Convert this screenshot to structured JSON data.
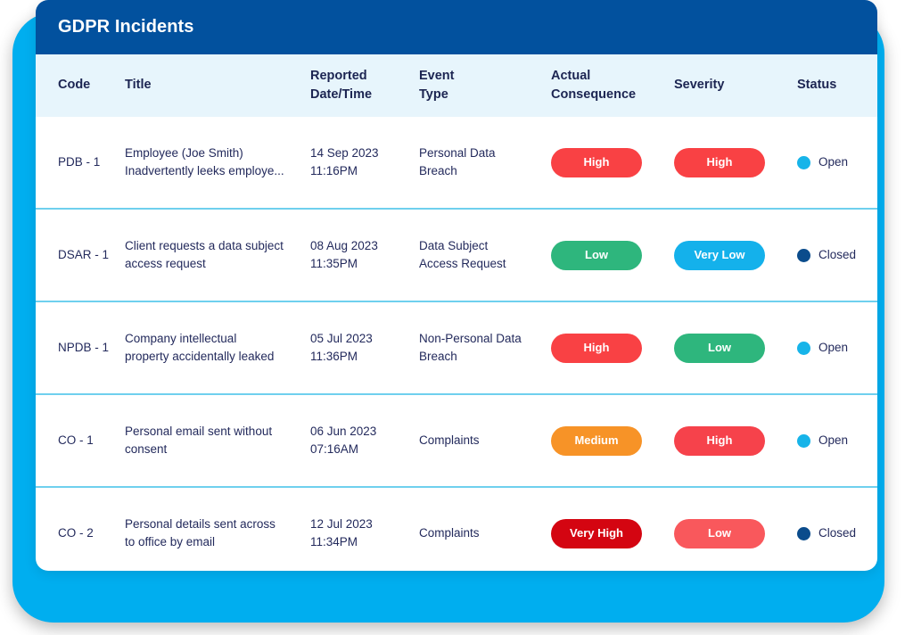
{
  "header": {
    "title": "GDPR Incidents",
    "bar_color": "#02519E",
    "text_color": "#FFFFFF"
  },
  "theme": {
    "backdrop_color": "#00AEEF",
    "card_color": "#FFFFFF",
    "table_header_bg": "#E7F5FC",
    "row_divider": "#6FD0EE",
    "text_color": "#232A5C"
  },
  "table": {
    "columns": [
      {
        "key": "code",
        "label": "Code"
      },
      {
        "key": "title",
        "label": "Title"
      },
      {
        "key": "reported",
        "label": "Reported\nDate/Time"
      },
      {
        "key": "event",
        "label": "Event\nType"
      },
      {
        "key": "cons",
        "label": "Actual\nConsequence"
      },
      {
        "key": "severity",
        "label": "Severity"
      },
      {
        "key": "status",
        "label": "Status"
      }
    ],
    "rows": [
      {
        "code": "PDB - 1",
        "title": "Employee (Joe Smith)\nInadvertently leeks employe...",
        "reported": "14 Sep 2023\n11:16PM",
        "event": "Personal Data\nBreach",
        "consequence": {
          "label": "High",
          "color": "#F94144"
        },
        "severity": {
          "label": "High",
          "color": "#F94144"
        },
        "status": {
          "label": "Open",
          "color": "#17B4E9"
        }
      },
      {
        "code": "DSAR - 1",
        "title": "Client requests a data subject\naccess request",
        "reported": "08 Aug 2023\n11:35PM",
        "event": "Data Subject\nAccess Request",
        "consequence": {
          "label": "Low",
          "color": "#2EB67D"
        },
        "severity": {
          "label": "Very Low",
          "color": "#14B1EB"
        },
        "status": {
          "label": "Closed",
          "color": "#0B4C8C"
        }
      },
      {
        "code": "NPDB - 1",
        "title": "Company intellectual\nproperty accidentally leaked",
        "reported": "05 Jul 2023\n11:36PM",
        "event": "Non-Personal Data\nBreach",
        "consequence": {
          "label": "High",
          "color": "#F94144"
        },
        "severity": {
          "label": "Low",
          "color": "#2EB67D"
        },
        "status": {
          "label": "Open",
          "color": "#17B4E9"
        }
      },
      {
        "code": "CO - 1",
        "title": "Personal email sent without\nconsent",
        "reported": "06 Jun 2023\n07:16AM",
        "event": "Complaints",
        "consequence": {
          "label": "Medium",
          "color": "#F79327"
        },
        "severity": {
          "label": "High",
          "color": "#F6424B"
        },
        "status": {
          "label": "Open",
          "color": "#17B4E9"
        }
      },
      {
        "code": "CO - 2",
        "title": "Personal details sent across\nto office by email",
        "reported": "12 Jul 2023\n11:34PM",
        "event": "Complaints",
        "consequence": {
          "label": "Very High",
          "color": "#D40511"
        },
        "severity": {
          "label": "Low",
          "color": "#F9585C"
        },
        "status": {
          "label": "Closed",
          "color": "#0B4C8C"
        }
      }
    ]
  }
}
